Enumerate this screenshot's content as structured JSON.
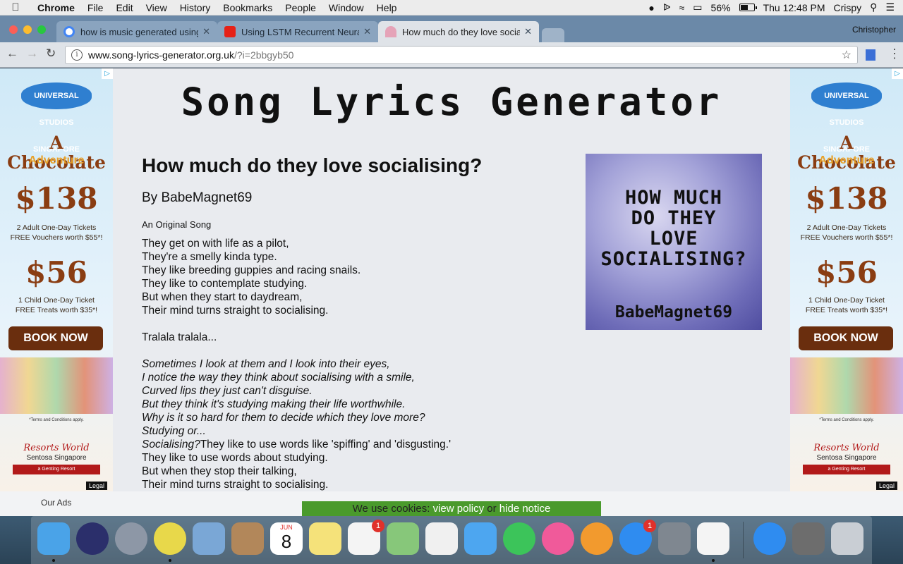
{
  "menubar": {
    "items": [
      "Chrome",
      "File",
      "Edit",
      "View",
      "History",
      "Bookmarks",
      "People",
      "Window",
      "Help"
    ],
    "battery_percent": "56%",
    "battery_level": 0.56,
    "clock": "Thu 12:48 PM",
    "user": "Crispy"
  },
  "browser": {
    "tabs": [
      {
        "title": "how is music generated using",
        "favicon": "google-icon"
      },
      {
        "title": "Using LSTM Recurrent Neural",
        "favicon": "youtube-icon"
      },
      {
        "title": "How much do they love sociali",
        "favicon": "umbrella-icon"
      }
    ],
    "profile": "Christopher",
    "url_domain": "www.song-lyrics-generator.org.uk",
    "url_path": "/?i=2bbgyb50"
  },
  "page": {
    "site_title": "Song Lyrics Generator",
    "song_title": "How much do they love socialising?",
    "byline": "By BabeMagnet69",
    "original": "An Original Song",
    "lyrics": [
      {
        "text": "They get on with life as a pilot,"
      },
      {
        "text": "They're a smelly kinda type."
      },
      {
        "text": "They like breeding guppies and racing snails."
      },
      {
        "text": "They like to contemplate studying."
      },
      {
        "text": "But when they start to daydream,"
      },
      {
        "text": "Their mind turns straight to socialising."
      },
      {
        "gap": true
      },
      {
        "text": "Tralala tralala..."
      },
      {
        "gap": true
      },
      {
        "text": "Sometimes I look at them and I look into their eyes,",
        "italic": true
      },
      {
        "text": "I notice the way they think about socialising with a smile,",
        "italic": true
      },
      {
        "text": "Curved lips they just can't disguise.",
        "italic": true
      },
      {
        "text": "But they think it's studying making their life worthwhile.",
        "italic": true
      },
      {
        "text": "Why is it so hard for them to decide which they love more?",
        "italic": true
      },
      {
        "text": "Studying or...",
        "italic": true
      },
      {
        "text": "Socialising?",
        "italic": true,
        "tail": "They like to use words like 'spiffing' and 'disgusting.'"
      },
      {
        "text": "They like to use words about studying."
      },
      {
        "text": "But when they stop their talking,"
      },
      {
        "text": "Their mind turns straight to socialising."
      },
      {
        "gap": true
      },
      {
        "text": "Tralala tralala..."
      }
    ],
    "cover": {
      "title_lines": [
        "HOW MUCH",
        "DO THEY",
        "LOVE",
        "SOCIALISING?"
      ],
      "author": "BabeMagnet69"
    },
    "our_ads": "Our Ads",
    "cookie": {
      "prefix": "We use cookies:",
      "view_policy": "view policy",
      "or": "or",
      "hide_notice": "hide notice"
    }
  },
  "ad": {
    "brand": "UNIVERSAL STUDIOS SINGAPORE",
    "headline": "A Chocolate",
    "headline2": "Adventure",
    "price1": "$138",
    "desc1_line1": "2 Adult One-Day Tickets",
    "desc1_line2": "FREE Vouchers worth $55*!",
    "price2": "$56",
    "desc2_line1": "1 Child One-Day Ticket",
    "desc2_line2": "FREE Treats worth $35*!",
    "cta": "BOOK NOW",
    "terms": "*Terms and Conditions apply.",
    "sponsor": "Resorts World",
    "sponsor_sub": "Sentosa Singapore",
    "sponsor_bar": "a Genting Resort",
    "legal": "Legal"
  },
  "dock": {
    "apps": [
      {
        "name": "finder-icon",
        "color": "#4aa3e8"
      },
      {
        "name": "siri-icon",
        "color": "#2b2f6b"
      },
      {
        "name": "launchpad-icon",
        "color": "#8d97a6"
      },
      {
        "name": "chrome-icon",
        "color": "#e8d84a"
      },
      {
        "name": "mail-icon",
        "color": "#7aa7d6"
      },
      {
        "name": "contacts-icon",
        "color": "#b2875a"
      },
      {
        "name": "calendar-icon",
        "color": "#ffffff",
        "day": "8",
        "month": "JUN"
      },
      {
        "name": "notes-icon",
        "color": "#f5e27a"
      },
      {
        "name": "reminders-icon",
        "color": "#f4f4f4",
        "badge": "1"
      },
      {
        "name": "maps-icon",
        "color": "#87c77a"
      },
      {
        "name": "photos-icon",
        "color": "#f0f0f0"
      },
      {
        "name": "messages-icon",
        "color": "#4da6f0"
      },
      {
        "name": "facetime-icon",
        "color": "#3cc45a"
      },
      {
        "name": "itunes-icon",
        "color": "#f05a9a"
      },
      {
        "name": "ibooks-icon",
        "color": "#f29a2e"
      },
      {
        "name": "app-store-icon",
        "color": "#2f8cf0",
        "badge": "1"
      },
      {
        "name": "system-preferences-icon",
        "color": "#7f8790"
      },
      {
        "name": "textedit-icon",
        "color": "#f4f4f4"
      },
      {
        "name": "app-store-folder-icon",
        "color": "#2f8cf0"
      },
      {
        "name": "downloads-stack-icon",
        "color": "#6d6d6d"
      },
      {
        "name": "trash-icon",
        "color": "#c9ced4"
      }
    ]
  }
}
